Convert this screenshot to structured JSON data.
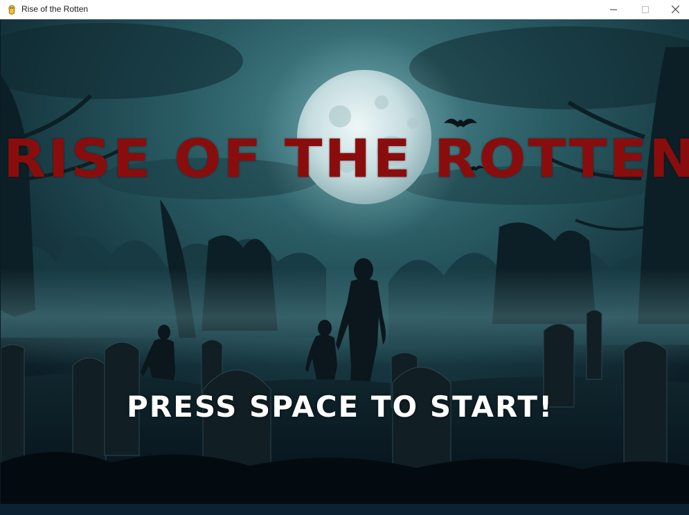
{
  "window": {
    "title": "Rise of the Rotten",
    "controls": [
      "minimize",
      "maximize",
      "close"
    ]
  },
  "game": {
    "title": "RISE OF THE ROTTEN",
    "prompt": "PRESS SPACE TO START!"
  },
  "icons": {
    "app": "pygame-snake-icon",
    "minimize": "minimize-icon",
    "maximize": "maximize-icon",
    "close": "close-icon"
  },
  "colors": {
    "title_red": "#8a0d0d",
    "prompt_white": "#ffffff",
    "sky": "#1c4a52",
    "moon": "#d8e8ea"
  }
}
